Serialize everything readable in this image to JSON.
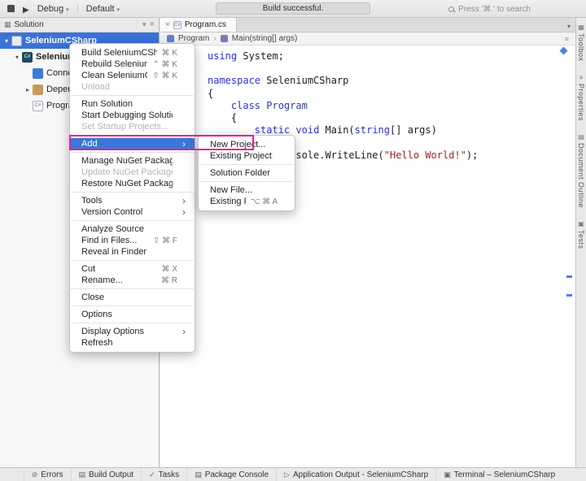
{
  "toolbar": {
    "config_label": "Debug",
    "target_label": "Default",
    "status_text": "Build successful.",
    "search_placeholder": "Press '⌘.' to search",
    "icons": [
      "stop-icon",
      "run-icon",
      "search-icon"
    ]
  },
  "solution_pad": {
    "title": "Solution",
    "tree": [
      {
        "label": "SeleniumCSharp",
        "icon": "solution",
        "indent": 0,
        "chevron": "expanded",
        "selected": true,
        "bold": true
      },
      {
        "label": "SeleniumCSharp",
        "icon": "project",
        "indent": 1,
        "chevron": "expanded",
        "bold": true
      },
      {
        "label": "Connected Services",
        "icon": "connected-services",
        "indent": 2
      },
      {
        "label": "Dependencies",
        "icon": "dependencies",
        "indent": 2,
        "chevron": "collapsed"
      },
      {
        "label": "Program.cs",
        "icon": "csharp-file",
        "indent": 2
      }
    ]
  },
  "editor": {
    "tab_title": "Program.cs",
    "breadcrumb_class": "Program",
    "breadcrumb_member": "Main(string[] args)",
    "code_lines": [
      {
        "tokens": [
          {
            "t": "using",
            "c": "kw"
          },
          {
            "t": " System;",
            "c": "id"
          }
        ]
      },
      {
        "tokens": []
      },
      {
        "tokens": [
          {
            "t": "namespace",
            "c": "kw"
          },
          {
            "t": " SeleniumCSharp",
            "c": "id"
          }
        ]
      },
      {
        "tokens": [
          {
            "t": "{",
            "c": "id"
          }
        ]
      },
      {
        "tokens": [
          {
            "t": "    ",
            "c": "id"
          },
          {
            "t": "class",
            "c": "kw"
          },
          {
            "t": " Program",
            "c": "type"
          }
        ]
      },
      {
        "tokens": [
          {
            "t": "    {",
            "c": "id"
          }
        ]
      },
      {
        "tokens": [
          {
            "t": "        ",
            "c": "id"
          },
          {
            "t": "static",
            "c": "kw"
          },
          {
            "t": " ",
            "c": "id"
          },
          {
            "t": "void",
            "c": "kw"
          },
          {
            "t": " Main(",
            "c": "id"
          },
          {
            "t": "string",
            "c": "kw"
          },
          {
            "t": "[] args)",
            "c": "id"
          }
        ]
      },
      {
        "tokens": [
          {
            "t": "        {",
            "c": "id"
          }
        ]
      },
      {
        "tokens": [
          {
            "t": "            Console.WriteLine(",
            "c": "id"
          },
          {
            "t": "\"Hello World!\"",
            "c": "str"
          },
          {
            "t": ");",
            "c": "id"
          }
        ]
      },
      {
        "tokens": [
          {
            "t": "        }",
            "c": "id"
          }
        ]
      },
      {
        "tokens": [
          {
            "t": "    }",
            "c": "id"
          }
        ]
      },
      {
        "tokens": [
          {
            "t": "}",
            "c": "id"
          }
        ]
      }
    ]
  },
  "context_menu": {
    "items": [
      {
        "label": "Build SeleniumCSharp",
        "shortcut": "⌘ K"
      },
      {
        "label": "Rebuild SeleniumCSharp",
        "shortcut": "⌃ ⌘ K"
      },
      {
        "label": "Clean SeleniumCSharp",
        "shortcut": "⇧ ⌘ K"
      },
      {
        "label": "Unload",
        "disabled": true
      },
      {
        "type": "separator"
      },
      {
        "label": "Run Solution"
      },
      {
        "label": "Start Debugging Solution"
      },
      {
        "label": "Set Startup Projects...",
        "disabled": true
      },
      {
        "type": "separator"
      },
      {
        "label": "Add",
        "submenu": true,
        "highlighted": true
      },
      {
        "type": "separator"
      },
      {
        "label": "Manage NuGet Packages..."
      },
      {
        "label": "Update NuGet Packages",
        "disabled": true
      },
      {
        "label": "Restore NuGet Packages"
      },
      {
        "type": "separator"
      },
      {
        "label": "Tools",
        "submenu": true
      },
      {
        "label": "Version Control",
        "submenu": true
      },
      {
        "type": "separator"
      },
      {
        "label": "Analyze Source"
      },
      {
        "label": "Find in Files...",
        "shortcut": "⇧ ⌘ F"
      },
      {
        "label": "Reveal in Finder"
      },
      {
        "type": "separator"
      },
      {
        "label": "Cut",
        "shortcut": "⌘ X"
      },
      {
        "label": "Rename...",
        "shortcut": "⌘ R"
      },
      {
        "type": "separator"
      },
      {
        "label": "Close"
      },
      {
        "type": "separator"
      },
      {
        "label": "Options"
      },
      {
        "type": "separator"
      },
      {
        "label": "Display Options",
        "submenu": true
      },
      {
        "label": "Refresh"
      }
    ]
  },
  "add_submenu": {
    "items": [
      {
        "label": "New Project..."
      },
      {
        "label": "Existing Project..."
      },
      {
        "type": "separator"
      },
      {
        "label": "Solution Folder"
      },
      {
        "type": "separator"
      },
      {
        "label": "New File..."
      },
      {
        "label": "Existing Files...",
        "shortcut": "⌥ ⌘ A"
      }
    ]
  },
  "right_dock": {
    "tabs": [
      {
        "label": "Toolbox",
        "icon": "toolbox"
      },
      {
        "label": "Properties",
        "icon": "properties"
      },
      {
        "label": "Document Outline",
        "icon": "document-outline"
      },
      {
        "label": "Tests",
        "icon": "tests"
      }
    ]
  },
  "bottom_bar": {
    "items": [
      {
        "label": "Errors",
        "icon": "errors"
      },
      {
        "label": "Build Output",
        "icon": "build-output"
      },
      {
        "label": "Tasks",
        "icon": "tasks"
      },
      {
        "label": "Package Console",
        "icon": "package-console"
      },
      {
        "label": "Application Output - SeleniumCSharp",
        "icon": "app-output"
      },
      {
        "label": "Terminal – SeleniumCSharp",
        "icon": "terminal"
      }
    ]
  },
  "accent_colors": {
    "selection_blue": "#3b76d9",
    "annotation_magenta": "#ec1e96",
    "keyword_blue": "#2d2de0",
    "string_red": "#a62121"
  }
}
